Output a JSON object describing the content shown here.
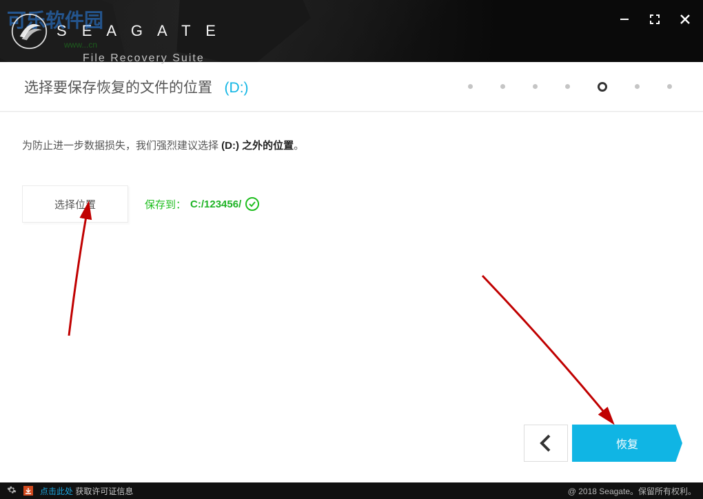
{
  "watermark": {
    "main": "可乐软件园",
    "sub": "www...cn"
  },
  "brand": {
    "name": "S E A G A T E",
    "suite": "File Recovery Suite"
  },
  "step": {
    "title_prefix": "选择要保存恢复的文件的位置",
    "title_drive": "(D:)",
    "active_index": 4,
    "total": 7
  },
  "content": {
    "hint_prefix": "为防止进一步数据损失，我们强烈建议选择 ",
    "hint_bold": "(D:) 之外的位置",
    "hint_suffix": "。",
    "select_location_btn": "选择位置",
    "save_to_label": "保存到：",
    "save_to_path": "C:/123456/"
  },
  "nav": {
    "recover_btn": "恢复"
  },
  "footer": {
    "click_here": "点击此处",
    "get_license": " 获取许可证信息",
    "copyright": "@ 2018 Seagate。保留所有权利。"
  }
}
